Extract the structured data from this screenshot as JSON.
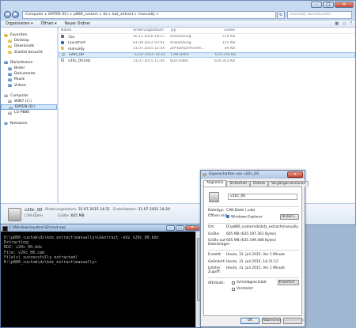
{
  "explorer": {
    "breadcrumb": [
      "Computer",
      "DATEN (D:)",
      "p880_custom",
      "dz",
      "kdz_extract",
      "manually"
    ],
    "search_placeholder": "manually durchsuchen",
    "toolbar": {
      "organize": "Organisieren ▾",
      "open": "Öffnen ▾",
      "new_folder": "Neuer Ordner"
    },
    "nav": {
      "favorites": "Favoriten",
      "favorite_items": [
        "Desktop",
        "Downloads",
        "Zuletzt besucht"
      ],
      "libraries": "Bibliotheken",
      "library_items": [
        "Bilder",
        "Dokumente",
        "Musik",
        "Videos"
      ],
      "computer": "Computer",
      "computer_items": [
        "WIN7 (C:)",
        "DATEN (D:)",
        "LG-P880"
      ],
      "network": "Netzwerk"
    },
    "columns": [
      "Name",
      "Änderungsdatum",
      "Typ",
      "Größe"
    ],
    "files": [
      {
        "name": "7za",
        "date": "16.11.2010 19:27",
        "type": "Anwendung",
        "size": "574 KB"
      },
      {
        "name": "LGExtract",
        "date": "01.04.2012 03:01",
        "type": "Anwendung",
        "size": "155 KB"
      },
      {
        "name": "manually",
        "date": "31.07.2015 11:44",
        "type": "ZIP-komprimierte...",
        "size": "49 KB"
      },
      {
        "name": "v20c_00",
        "date": "31.07.2015 14:21",
        "type": "CAB-Datei",
        "size": "620.316 KB"
      },
      {
        "name": "v20c_00.kdz",
        "date": "31.07.2015 11:44",
        "type": "KDZ-Datei",
        "size": "620.353 KB"
      }
    ],
    "details": {
      "name": "v20c_00",
      "type": "CAB-Datei",
      "mod_label": "Änderungsdatum:",
      "mod_value": "31.07.2015 14:21",
      "size_label": "Größe:",
      "size_value": "605 MB",
      "created_label": "Erstelldatum:",
      "created_value": "31.07.2015 14:20"
    }
  },
  "cmd": {
    "title": "C:\\Windows\\system32\\cmd.exe",
    "lines": [
      "D:\\p880_custom\\dz\\kdz_extract\\manually>LGextract -kdz v20c_00.kdz",
      "Extracting:",
      "KDZ: v20c_00.kdz",
      "",
      "File: v20c_00.cab",
      "File(s) successfully extracted!",
      "",
      "D:\\p880_custom\\dz\\kdz_extract\\manually>"
    ]
  },
  "props": {
    "title": "Eigenschaften von v20c_00",
    "tabs": [
      "Allgemein",
      "Sicherheit",
      "Details",
      "Vorgängerversionen"
    ],
    "filename": "v20c_00",
    "rows": {
      "filetype_label": "Dateityp:",
      "filetype_value": "CAB-Datei (.cab)",
      "opens_label": "Öffnen mit:",
      "opens_value": "Windows-Explorer",
      "change_button": "Ändern...",
      "location_label": "Ort:",
      "location_value": "D:\\p880_custom\\dz\\kdz_extract\\manually",
      "size_label": "Größe:",
      "size_value": "605 MB (635.197.361 Bytes)",
      "disk_label1": "Größe auf",
      "disk_label2": "Datenträger:",
      "disk_value": "605 MB (635.199.488 Bytes)",
      "created_label": "Erstellt:",
      "created_value": "Heute, 31. Juli 2015, Vor 1 Minute",
      "modified_label": "Geändert:",
      "modified_value": "Heute, 31. Juli 2015, 14:21:12",
      "accessed_label1": "Letzter",
      "accessed_label2": "Zugriff:",
      "accessed_value": "Heute, 31. Juli 2015, Vor 1 Minute",
      "attr_label": "Attribute:",
      "readonly": "Schreibgeschützt",
      "hidden": "Versteckt",
      "advanced_button": "Erweitert..."
    },
    "footer": {
      "ok": "OK",
      "cancel": "Abbrechen",
      "apply": "Übernehmen"
    }
  }
}
